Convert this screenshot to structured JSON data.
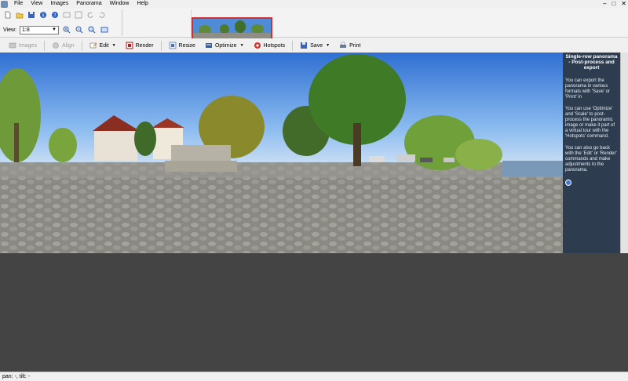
{
  "menubar": {
    "items": [
      "File",
      "View",
      "Images",
      "Panorama",
      "Window",
      "Help"
    ],
    "window_controls": [
      "–",
      "□",
      "✕"
    ]
  },
  "top_toolbar": {
    "icons": [
      "new-file-icon",
      "open-folder-icon",
      "save-icon",
      "info-icon",
      "help-icon",
      "zoom-in-icon",
      "zoom-out-icon",
      "rotate-left-icon",
      "rotate-right-icon"
    ],
    "view_label": "View:",
    "view_value": "1:8"
  },
  "toolbar2": {
    "buttons": [
      {
        "label": "Images",
        "icon": "images-icon",
        "enabled": false
      },
      {
        "label": "Align",
        "icon": "align-icon",
        "enabled": false
      },
      {
        "label": "Edit",
        "icon": "edit-icon",
        "enabled": true,
        "dropdown": true
      },
      {
        "label": "Render",
        "icon": "render-icon",
        "enabled": true
      },
      {
        "label": "Resize",
        "icon": "resize-icon",
        "enabled": true
      },
      {
        "label": "Optimize",
        "icon": "optimize-icon",
        "enabled": true,
        "dropdown": true
      },
      {
        "label": "Hotspots",
        "icon": "hotspots-icon",
        "enabled": true
      },
      {
        "label": "Save",
        "icon": "save-icon",
        "enabled": true,
        "dropdown": true
      },
      {
        "label": "Print",
        "icon": "print-icon",
        "enabled": true
      }
    ]
  },
  "help": {
    "title": "Single-row panorama - Post-process and export",
    "paragraphs": [
      "You can export the panorama in various formats with 'Save' or 'Print' in",
      "You can use 'Optimize' and 'Scale' to post-process the panoramic image or make it part of a virtual tour with the 'Hotspots' command.",
      "You can also go back with the 'Edit' or 'Render' commands and make adjustments to the panorama."
    ]
  },
  "status": {
    "text": "pan: -, tilt: -"
  },
  "colors": {
    "workspace": "#444444",
    "help_panel": "#1e375a",
    "thumb_border": "#d03030"
  }
}
